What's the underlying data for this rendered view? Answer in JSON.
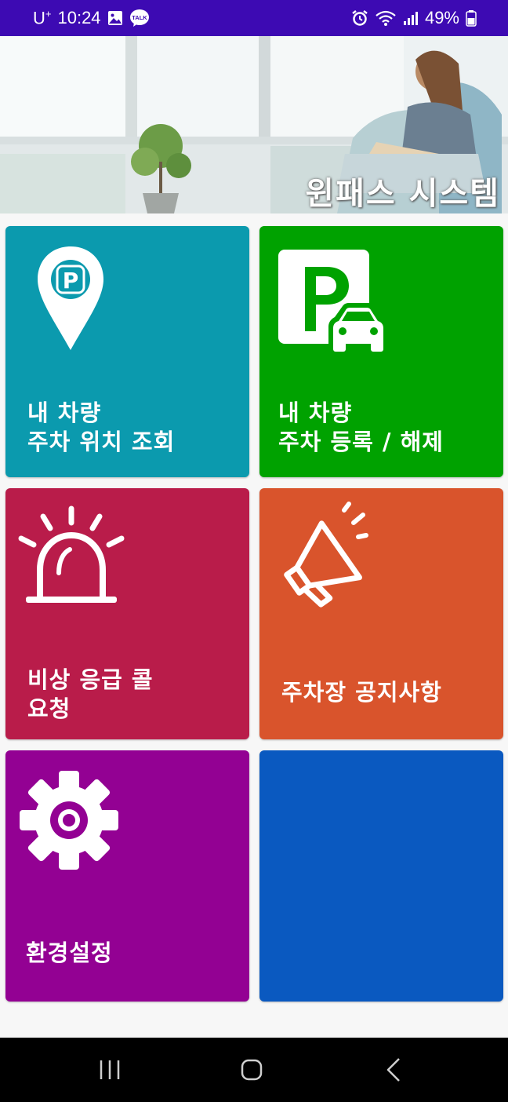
{
  "status_bar": {
    "carrier": "U",
    "carrier_sup": "+",
    "time": "10:24",
    "battery": "49%",
    "icons": [
      "gallery-icon",
      "kakaotalk-icon",
      "alarm-icon",
      "wifi-icon",
      "signal-icon",
      "battery-icon"
    ],
    "talk_badge": "TALK",
    "background": "#3d0ab3"
  },
  "hero": {
    "title": "윈패스 시스템"
  },
  "tiles": [
    {
      "label": "내 차량\n주차 위치 조회",
      "icon": "parking-location-pin-icon",
      "color": "#0b9aae"
    },
    {
      "label": "내 차량\n주차 등록 / 해제",
      "icon": "parking-car-icon",
      "color": "#00a200"
    },
    {
      "label": "비상 응급 콜\n요청",
      "icon": "emergency-siren-icon",
      "color": "#b91c4a"
    },
    {
      "label": "주차장 공지사항",
      "icon": "megaphone-icon",
      "color": "#d9542c"
    },
    {
      "label": "환경설정",
      "icon": "gear-icon",
      "color": "#930193"
    },
    {
      "label": "",
      "icon": "",
      "color": "#0a59c0"
    }
  ],
  "nav_bar": {
    "buttons": [
      "recent-apps-icon",
      "home-icon",
      "back-icon"
    ]
  }
}
